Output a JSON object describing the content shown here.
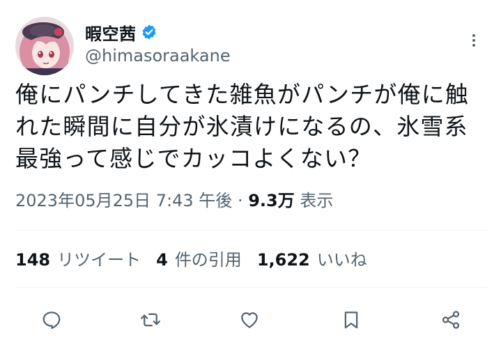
{
  "user": {
    "display_name": "暇空茜",
    "handle": "@himasoraakane",
    "verified": true,
    "avatar": "anime-girl-avatar-icon"
  },
  "tweet": {
    "lines": [
      "俺にパンチしてきた雑魚がパンチが俺に触",
      "れた瞬間に自分が氷漬けになるの、氷雪系",
      "最強って感じでカッコよくない？"
    ]
  },
  "meta": {
    "timestamp": "2023年05月25日 7:43 午後",
    "separator": "·",
    "views_count": "9.3万",
    "views_label": "表示"
  },
  "stats": {
    "retweets_count": "148",
    "retweets_label": "リツイート",
    "quotes_count": "4",
    "quotes_label": "件の引用",
    "likes_count": "1,622",
    "likes_label": "いいね"
  },
  "actions": {
    "reply": "reply-icon",
    "retweet": "retweet-icon",
    "like": "heart-icon",
    "bookmark": "bookmark-icon",
    "share": "share-icon"
  },
  "colors": {
    "text": "#0f1419",
    "secondary": "#536471",
    "verified": "#1d9bf0",
    "divider": "#eff3f4"
  }
}
